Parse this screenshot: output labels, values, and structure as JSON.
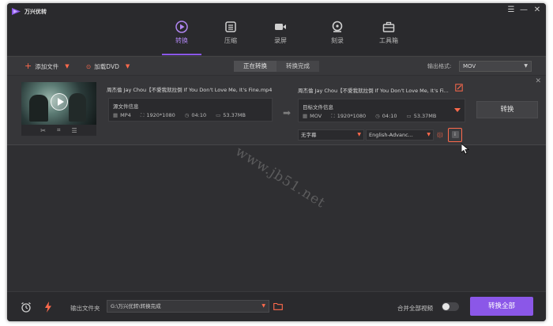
{
  "app": {
    "title": "万兴优转"
  },
  "window_controls": {
    "menu": "☰",
    "minimize": "—",
    "close": "✕"
  },
  "nav": [
    {
      "label": "转换",
      "icon": "convert-icon",
      "active": true
    },
    {
      "label": "压缩",
      "icon": "compress-icon",
      "active": false
    },
    {
      "label": "录屏",
      "icon": "record-screen-icon",
      "active": false
    },
    {
      "label": "刻录",
      "icon": "burn-disc-icon",
      "active": false
    },
    {
      "label": "工具箱",
      "icon": "toolbox-icon",
      "active": false
    }
  ],
  "toolbar": {
    "add_file": "添加文件",
    "load_dvd": "加载DVD",
    "tab_converting": "正在转换",
    "tab_done": "转换完成",
    "output_format_label": "输出格式:",
    "output_format_value": "MOV"
  },
  "item": {
    "source_filename": "周杰倫 Jay Chou【不愛我就拉倒 If You Don't Love Me, It's Fine.mp4",
    "target_filename": "周杰倫 Jay Chou【不愛我就拉倒 If You Don't Love Me, It's Fi...",
    "source_info": {
      "header": "源文件信息",
      "format": "MP4",
      "resolution": "1920*1080",
      "duration": "04:10",
      "size": "53.37MB"
    },
    "target_info": {
      "header": "目标文件信息",
      "format": "MOV",
      "resolution": "1920*1080",
      "duration": "04:10",
      "size": "53.37MB"
    },
    "convert_label": "转换",
    "subtitle_select": "无字幕",
    "audio_select": "English-Advanc..."
  },
  "watermark": "www.jb51.net",
  "bottom": {
    "output_folder_label": "输出文件夹",
    "output_path": "G:\\万兴优转\\转换完成",
    "merge_label": "合并全部视频",
    "merge_enabled": false,
    "convert_all_label": "转换全部"
  },
  "colors": {
    "accent_purple": "#8b57e8",
    "accent_orange": "#ff6a4c",
    "background": "#2f2f32"
  }
}
